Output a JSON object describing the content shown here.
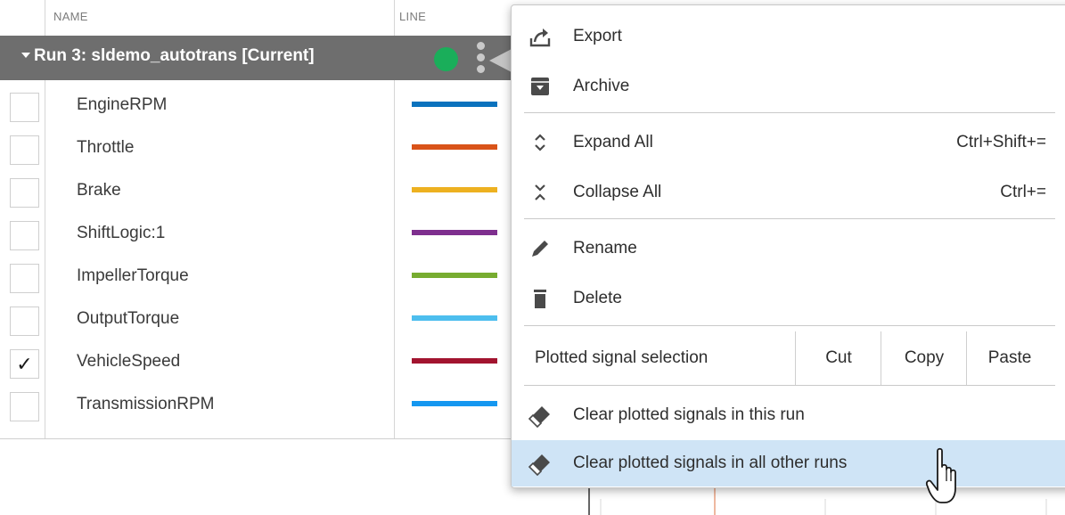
{
  "table": {
    "columns": {
      "name": "NAME",
      "line": "LINE"
    },
    "run": {
      "label": "Run 3: sldemo_autotrans [Current]",
      "status_color": "#1aae5a"
    },
    "signals": [
      {
        "name": "EngineRPM",
        "color": "#0a72bd",
        "checked": false
      },
      {
        "name": "Throttle",
        "color": "#d95319",
        "checked": false
      },
      {
        "name": "Brake",
        "color": "#edb120",
        "checked": false
      },
      {
        "name": "ShiftLogic:1",
        "color": "#7e2f8e",
        "checked": false
      },
      {
        "name": "ImpellerTorque",
        "color": "#77ac30",
        "checked": false
      },
      {
        "name": "OutputTorque",
        "color": "#4dbeee",
        "checked": false
      },
      {
        "name": "VehicleSpeed",
        "color": "#a2142f",
        "checked": true,
        "check_mark": "✓"
      },
      {
        "name": "TransmissionRPM",
        "color": "#1597f0",
        "checked": false
      }
    ]
  },
  "menu": {
    "export_label": "Export",
    "archive_label": "Archive",
    "expand_all_label": "Expand All",
    "expand_all_shortcut": "Ctrl+Shift+=",
    "collapse_all_label": "Collapse All",
    "collapse_all_shortcut": "Ctrl+=",
    "rename_label": "Rename",
    "delete_label": "Delete",
    "plotted_selection": {
      "label": "Plotted signal selection",
      "cut": "Cut",
      "copy": "Copy",
      "paste": "Paste"
    },
    "clear_this_run_label": "Clear plotted signals in this run",
    "clear_other_runs_label": "Clear plotted signals in all other runs",
    "highlight_color": "#cfe4f6"
  }
}
